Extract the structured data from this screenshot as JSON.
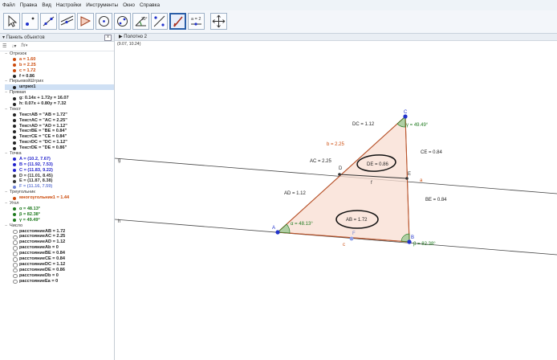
{
  "menu": [
    "Файл",
    "Правка",
    "Вид",
    "Настройки",
    "Инструменты",
    "Окно",
    "Справка"
  ],
  "toolbar": {
    "tools": [
      "move-tool",
      "point-tool",
      "line-tool",
      "perpendicular-line-tool",
      "polygon-tool",
      "circle-tool",
      "ellipse-tool",
      "angle-tool",
      "reflect-tool",
      "slider-tool",
      "move-view-tool"
    ],
    "slider_label": "a = 2",
    "active_tool": "reflect-tool"
  },
  "left_panel": {
    "title": "Панель объектов",
    "close_label": "x"
  },
  "tree": [
    {
      "type": "cat",
      "label": "Отрезок"
    },
    {
      "type": "item",
      "label": "a = 1.60",
      "color": "#cc4b0c"
    },
    {
      "type": "item",
      "label": "b = 2.25",
      "color": "#cc4b0c"
    },
    {
      "type": "item",
      "label": "c = 1.72",
      "color": "#cc4b0c"
    },
    {
      "type": "item",
      "label": "f = 0.86",
      "color": "#222222"
    },
    {
      "type": "cat",
      "label": "ПерьевойШтрих"
    },
    {
      "type": "item",
      "label": "штрих1",
      "color": "#222222",
      "sel": true
    },
    {
      "type": "cat",
      "label": "Прямая"
    },
    {
      "type": "item",
      "label": "g: 0.14x + 1.72y = 16.07",
      "color": "#222222"
    },
    {
      "type": "item",
      "label": "h: 0.07x + 0.80y = 7.32",
      "color": "#222222"
    },
    {
      "type": "cat",
      "label": "Текст"
    },
    {
      "type": "item",
      "label": "ТекстAB = \"AB = 1.72\"",
      "color": "#222222"
    },
    {
      "type": "item",
      "label": "ТекстAC = \"AC = 2.25\"",
      "color": "#222222"
    },
    {
      "type": "item",
      "label": "ТекстAD = \"AD = 1.12\"",
      "color": "#222222"
    },
    {
      "type": "item",
      "label": "ТекстBE = \"BE = 0.84\"",
      "color": "#222222"
    },
    {
      "type": "item",
      "label": "ТекстCE = \"CE = 0.84\"",
      "color": "#222222"
    },
    {
      "type": "item",
      "label": "ТекстDC = \"DC = 1.12\"",
      "color": "#222222"
    },
    {
      "type": "item",
      "label": "ТекстDE = \"DE = 0.86\"",
      "color": "#222222"
    },
    {
      "type": "cat",
      "label": "Точка"
    },
    {
      "type": "item",
      "label": "A = (10.2, 7.67)",
      "color": "#2222cc"
    },
    {
      "type": "item",
      "label": "B = (11.92, 7.53)",
      "color": "#2222cc"
    },
    {
      "type": "item",
      "label": "C = (11.83, 9.22)",
      "color": "#2222cc"
    },
    {
      "type": "item",
      "label": "D = (11.01, 8.45)",
      "color": "#333333"
    },
    {
      "type": "item",
      "label": "E = (11.87, 8.38)",
      "color": "#333333"
    },
    {
      "type": "item",
      "label": "F = (11.16, 7.59)",
      "color": "#6b7fd6"
    },
    {
      "type": "cat",
      "label": "Треугольник"
    },
    {
      "type": "item",
      "label": "многоугольник1 = 1.44",
      "color": "#cc4b0c"
    },
    {
      "type": "cat",
      "label": "Угол"
    },
    {
      "type": "item",
      "label": "α = 48.13°",
      "color": "#1e7a1e"
    },
    {
      "type": "item",
      "label": "β = 82.38°",
      "color": "#1e7a1e"
    },
    {
      "type": "item",
      "label": "γ = 49.49°",
      "color": "#1e7a1e"
    },
    {
      "type": "cat",
      "label": "Число"
    },
    {
      "type": "num",
      "label": "расстояниеAB = 1.72"
    },
    {
      "type": "num",
      "label": "расстояниеAC = 2.25"
    },
    {
      "type": "num",
      "label": "расстояниеAD = 1.12"
    },
    {
      "type": "num",
      "label": "расстояниеAb = 0"
    },
    {
      "type": "num",
      "label": "расстояниеBE = 0.84"
    },
    {
      "type": "num",
      "label": "расстояниеCE = 0.84"
    },
    {
      "type": "num",
      "label": "расстояниеDC = 1.12"
    },
    {
      "type": "num",
      "label": "расстояниеDE = 0.86"
    },
    {
      "type": "num",
      "label": "расстояниеDb = 0"
    },
    {
      "type": "num",
      "label": "расстояниеEa = 0"
    }
  ],
  "graphics": {
    "title": "Полотно 2",
    "coords": "(9.07, 10.24)",
    "labels": {
      "g": "g",
      "h": "h",
      "A": "A",
      "B": "B",
      "C": "C",
      "D": "D",
      "E": "E",
      "F": "F",
      "a": "a",
      "b": "b = 2.25",
      "c": "c",
      "f": "f",
      "AC": "AC = 2.25",
      "AD": "AD = 1.12",
      "DC": "DC = 1.12",
      "CE": "CE = 0.84",
      "BE": "BE = 0.84",
      "DE": "DE = 0.86",
      "AB": "AB = 1.72",
      "alpha": "α = 48.13°",
      "beta": "β = 82.38°",
      "gamma": "γ = 49.49°"
    }
  }
}
